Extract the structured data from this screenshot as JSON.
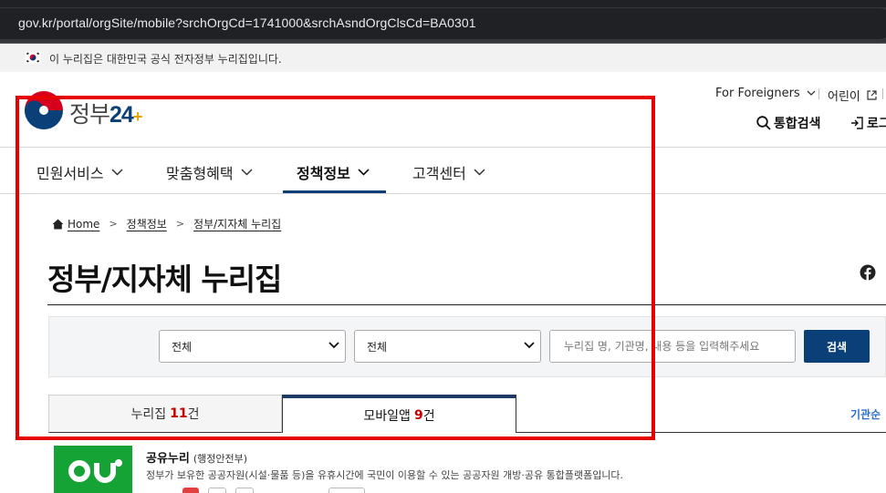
{
  "browser": {
    "url": "gov.kr/portal/orgSite/mobile?srchOrgCd=1741000&srchAsndOrgClsCd=BA0301"
  },
  "gov_banner": {
    "text": "이 누리집은 대한민국 공식 전자정부 누리집입니다."
  },
  "header": {
    "logo_text": "정부",
    "logo_num": "24",
    "for_foreigners": "For Foreigners",
    "child": "어린이",
    "search": "통합검색",
    "login": "로그"
  },
  "nav": {
    "items": [
      {
        "label": "민원서비스"
      },
      {
        "label": "맞춤형혜택"
      },
      {
        "label": "정책정보"
      },
      {
        "label": "고객센터"
      }
    ],
    "active_index": 2
  },
  "breadcrumb": [
    "Home",
    "정책정보",
    "정부/지자체 누리집"
  ],
  "page": {
    "title": "정부/지자체 누리집"
  },
  "filters": {
    "select1": "전체",
    "select2": "전체",
    "search_placeholder": "누리집 명, 기관명, 내용 등을 입력해주세요",
    "search_button": "검색"
  },
  "tabs": [
    {
      "label": "누리집",
      "count": "11",
      "suffix": "건"
    },
    {
      "label": "모바일앱",
      "count": "9",
      "suffix": "건"
    }
  ],
  "sort": {
    "label": "기관순"
  },
  "result": {
    "name": "공유누리",
    "org": "(행정안전부)",
    "desc": "정부가 보유한 공공자원(시설·물품 등)을 유휴시간에 국민이 이용할 수 있는 공공자원 개방·공유 통합플랫폼입니다."
  },
  "colors": {
    "brand": "#0b3f78",
    "accent_red": "#c40000",
    "frame": "#e60000",
    "app_green": "#15a335"
  }
}
